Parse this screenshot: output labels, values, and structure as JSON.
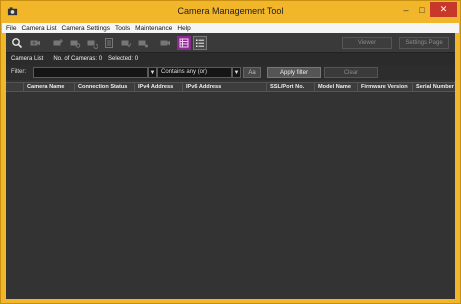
{
  "window": {
    "title": "Camera Management Tool",
    "minimize_glyph": "–",
    "maximize_glyph": "□",
    "close_glyph": "✕"
  },
  "menu": [
    "File",
    "Camera List",
    "Camera Settings",
    "Tools",
    "Maintenance",
    "Help"
  ],
  "toolbar": {
    "icons": [
      "search-icon",
      "camera-icon",
      "camera-add-icon",
      "camera-settings-icon",
      "camera-refresh-icon",
      "document-icon",
      "camera-check-icon",
      "camera-network-icon",
      "camera-ip-icon",
      "grid-view-icon",
      "list-view-icon"
    ],
    "viewer_label": "Viewer",
    "settings_page_label": "Settings Page"
  },
  "camera_list": {
    "title": "Camera List",
    "count_text": "No. of Cameras: 0",
    "selected_text": "Selected: 0"
  },
  "filter": {
    "label": "Filter:",
    "value": "",
    "mode": "Contains any (or)",
    "case_label": "Aa",
    "apply_label": "Apply filter",
    "clear_label": "Clear"
  },
  "table": {
    "columns": [
      "Camera Name",
      "Connection Status",
      "IPv4 Address",
      "IPv6 Address",
      "SSL/Port No.",
      "Model Name",
      "Firmware Version",
      "Serial Number"
    ],
    "rows": []
  },
  "colors": {
    "accent": "#f2b62a",
    "active_view": "#8a2a8e",
    "close_button": "#c7382b"
  }
}
